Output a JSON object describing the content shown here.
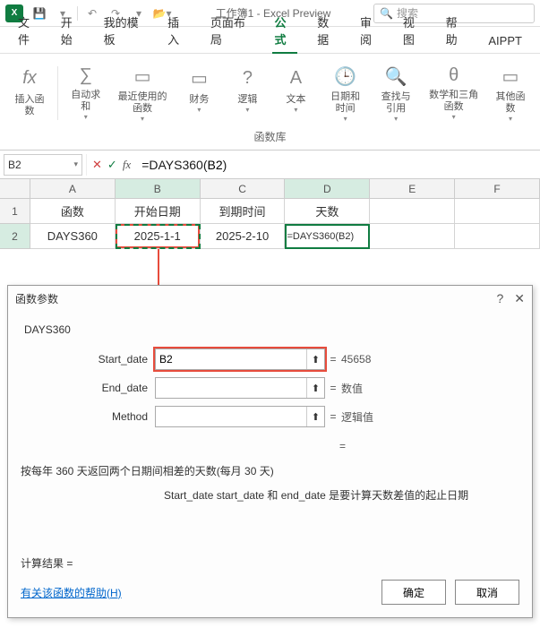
{
  "titlebar": {
    "app_letter": "X",
    "doc_title": "工作簿1 - Excel Preview",
    "search_placeholder": "搜索"
  },
  "menu": {
    "items": [
      "文件",
      "开始",
      "我的模板",
      "插入",
      "页面布局",
      "公式",
      "数据",
      "审阅",
      "视图",
      "帮助",
      "AIPPT"
    ],
    "active_index": 5
  },
  "ribbon": {
    "buttons": [
      {
        "label": "插入函数",
        "caret": false
      },
      {
        "label": "自动求和",
        "caret": true
      },
      {
        "label": "最近使用的函数",
        "caret": true
      },
      {
        "label": "财务",
        "caret": true
      },
      {
        "label": "逻辑",
        "caret": true
      },
      {
        "label": "文本",
        "caret": true
      },
      {
        "label": "日期和时间",
        "caret": true
      },
      {
        "label": "查找与引用",
        "caret": true
      },
      {
        "label": "数学和三角函数",
        "caret": true
      },
      {
        "label": "其他函数",
        "caret": true
      }
    ],
    "group_title": "函数库"
  },
  "formulabar": {
    "namebox": "B2",
    "formula_prefix": "=DAYS360(",
    "formula_arg": "B2",
    "formula_suffix": ")"
  },
  "grid": {
    "columns": [
      "A",
      "B",
      "C",
      "D",
      "E",
      "F"
    ],
    "row1": {
      "A": "函数",
      "B": "开始日期",
      "C": "到期时间",
      "D": "天数"
    },
    "row2": {
      "A": "DAYS360",
      "B": "2025-1-1",
      "C": "2025-2-10",
      "D": "=DAYS360(B2)"
    }
  },
  "dialog": {
    "title": "函数参数",
    "fn": "DAYS360",
    "params": [
      {
        "label": "Start_date",
        "value": "B2",
        "result": "45658",
        "highlight": true
      },
      {
        "label": "End_date",
        "value": "",
        "result": "数值",
        "highlight": false
      },
      {
        "label": "Method",
        "value": "",
        "result": "逻辑值",
        "highlight": false
      }
    ],
    "eq_alone": "=",
    "desc1": "按每年 360 天返回两个日期间相差的天数(每月 30 天)",
    "desc2": "Start_date  start_date 和 end_date 是要计算天数差值的起止日期",
    "result_label": "计算结果 =",
    "help_link": "有关该函数的帮助(H)",
    "ok": "确定",
    "cancel": "取消"
  }
}
